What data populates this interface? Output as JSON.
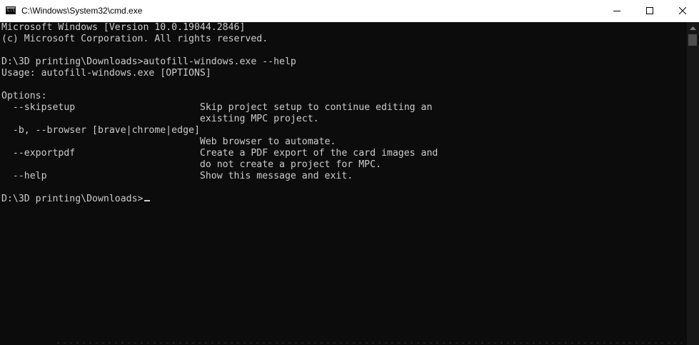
{
  "window": {
    "title": "C:\\Windows\\System32\\cmd.exe"
  },
  "terminal": {
    "lines": [
      "Microsoft Windows [Version 10.0.19044.2846]",
      "(c) Microsoft Corporation. All rights reserved.",
      "",
      "D:\\3D printing\\Downloads>autofill-windows.exe --help",
      "Usage: autofill-windows.exe [OPTIONS]",
      "",
      "Options:",
      "  --skipsetup                      Skip project setup to continue editing an",
      "                                   existing MPC project.",
      "  -b, --browser [brave|chrome|edge]",
      "                                   Web browser to automate.",
      "  --exportpdf                      Create a PDF export of the card images and",
      "                                   do not create a project for MPC.",
      "  --help                           Show this message and exit.",
      "",
      "D:\\3D printing\\Downloads>"
    ]
  },
  "icons": {
    "app": "cmd-icon",
    "minimize": "minimize-icon",
    "maximize": "maximize-icon",
    "close": "close-icon",
    "scroll_up": "scroll-up-arrow-icon"
  },
  "colors": {
    "background": "#0c0c0c",
    "text": "#cccccc",
    "titlebar": "#ffffff"
  }
}
